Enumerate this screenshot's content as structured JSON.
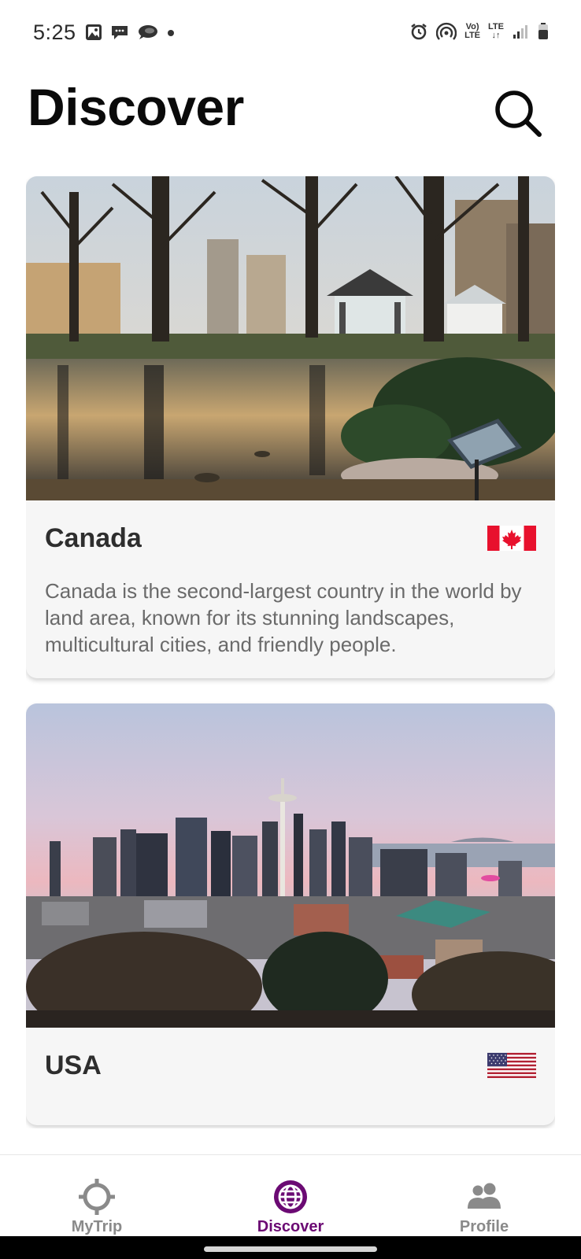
{
  "status_bar": {
    "time": "5:25",
    "volte": "Vo)",
    "volte_sub": "LTE",
    "lte": "LTE",
    "lte_sub": "↓↑"
  },
  "header": {
    "title": "Discover"
  },
  "cards": [
    {
      "title": "Canada",
      "description": "Canada is the second-largest country in the world by land area, known for its stunning landscapes, multicultural cities, and friendly people.",
      "flag": "canada-flag-icon"
    },
    {
      "title": "USA",
      "description": "",
      "flag": "usa-flag-icon"
    }
  ],
  "bottom_nav": {
    "items": [
      {
        "label": "MyTrip",
        "icon": "crosshair-icon",
        "active": false
      },
      {
        "label": "Discover",
        "icon": "globe-icon",
        "active": true
      },
      {
        "label": "Profile",
        "icon": "people-icon",
        "active": false
      }
    ]
  },
  "colors": {
    "accent": "#6b0a73",
    "inactive": "#8a8a8a",
    "card_background": "#f6f6f6",
    "canada_red": "#e8112d",
    "usa_red": "#b22234",
    "usa_blue": "#3c3b6e"
  }
}
